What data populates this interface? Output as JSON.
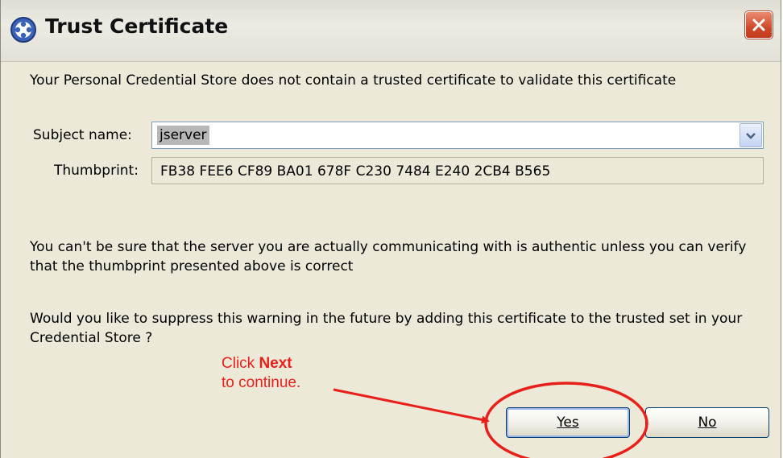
{
  "window": {
    "title": "Trust Certificate",
    "title_icon": "globe-shield-icon",
    "close_icon": "close-icon"
  },
  "message": "Your Personal Credential Store does not contain a trusted certificate to validate this certificate",
  "subject": {
    "label": "Subject name:",
    "value": "jserver"
  },
  "thumbprint": {
    "label": "Thumbprint:",
    "value": "FB38 FEE6 CF89 BA01 678F C230 7484 E240 2CB4 B565"
  },
  "warning": "You can't be sure that the server you are actually communicating with is authentic unless you can verify that the thumbprint presented above is correct",
  "question": "Would you like to suppress this warning in the future by adding this certificate to the trusted set in your Credential Store ?",
  "buttons": {
    "yes": "Yes",
    "no": "No"
  },
  "annotation": {
    "line1_prefix": "Click ",
    "line1_bold": "Next",
    "line2": "to continue.",
    "color": "#e8201a"
  },
  "colors": {
    "dialog_bg": "#ece9d8",
    "close_button": "#cf4a2a",
    "selection": "#b7b7b7"
  }
}
